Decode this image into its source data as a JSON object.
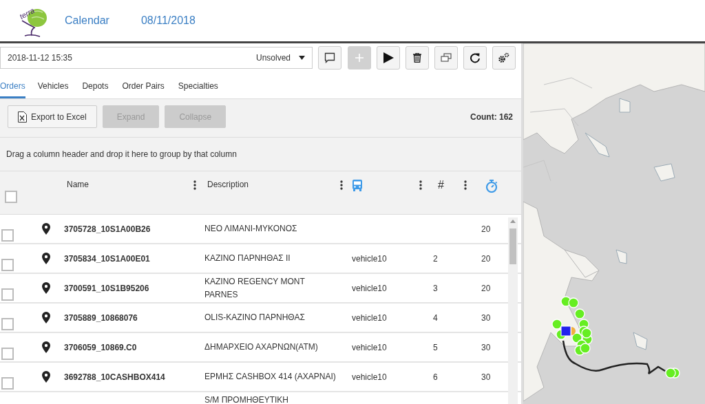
{
  "header": {
    "logo_text": "terra",
    "title": "Calendar",
    "date": "08/11/2018"
  },
  "toolbar": {
    "datetime": "2018-11-12 15:35",
    "status": "Unsolved",
    "buttons": [
      {
        "kind": "comment",
        "disabled": false
      },
      {
        "kind": "add",
        "disabled": true
      },
      {
        "kind": "play",
        "disabled": false
      },
      {
        "kind": "delete",
        "disabled": false
      },
      {
        "kind": "copy",
        "disabled": false
      },
      {
        "kind": "refresh",
        "disabled": false
      },
      {
        "kind": "settings",
        "disabled": false
      }
    ]
  },
  "tabs": [
    {
      "label": "Orders",
      "selected": true
    },
    {
      "label": "Vehicles",
      "selected": false
    },
    {
      "label": "Depots",
      "selected": false
    },
    {
      "label": "Order Pairs",
      "selected": false
    },
    {
      "label": "Specialties",
      "selected": false
    }
  ],
  "actions": [
    {
      "kind": "excel",
      "label": "Export to Excel",
      "disabled": false
    },
    {
      "kind": "plain",
      "label": "Expand",
      "disabled": true
    },
    {
      "kind": "plain",
      "label": "Collapse",
      "disabled": true
    }
  ],
  "count": "Count: 162",
  "group_hint": "Drag a column header and drop it here to group by that column",
  "table": {
    "select_all": {
      "checked": false
    },
    "columns": [
      {
        "kind": "text",
        "label": "Name"
      },
      {
        "kind": "text",
        "label": "Description"
      },
      {
        "kind": "vehicle"
      },
      {
        "kind": "text",
        "label": "#"
      },
      {
        "kind": "duration"
      }
    ],
    "rows": [
      {
        "checked": false,
        "name": "3705728_10S1A00B26",
        "description": "ΝΕΟ ΛΙΜΑΝΙ-ΜΥΚΟΝΟΣ",
        "duration": "20"
      },
      {
        "checked": false,
        "name": "3705834_10S1A00E01",
        "description": "ΚΑΖΙΝΟ ΠΑΡΝΗΘΑΣ ΙΙ",
        "vehicle": "vehicle10",
        "sequence": "2",
        "duration": "20"
      },
      {
        "checked": false,
        "name": "3700591_10S1B95206",
        "description": "KAZINO REGENCY MONT PARNES",
        "vehicle": "vehicle10",
        "sequence": "3",
        "duration": "20"
      },
      {
        "checked": false,
        "name": "3705889_10868076",
        "description": "OLIS-ΚΑΖΙΝΟ ΠΑΡΝΗΘΑΣ",
        "vehicle": "vehicle10",
        "sequence": "4",
        "duration": "30"
      },
      {
        "checked": false,
        "name": "3706059_10869.C0",
        "description": "ΔΗΜΑΡΧΕΙΟ ΑΧΑΡΝΩΝ(ATM)",
        "vehicle": "vehicle10",
        "sequence": "5",
        "duration": "30"
      },
      {
        "checked": false,
        "name": "3692788_10CASHBOX414",
        "description": "ΕΡΜΗΣ CASHBOX 414 (ΑΧΑΡΝΑΙ)",
        "vehicle": "vehicle10",
        "sequence": "6",
        "duration": "30"
      },
      {
        "kind": "partial",
        "description": "S/M ΠΡΟΜΗΘΕΥΤΙΚΗ"
      }
    ]
  }
}
